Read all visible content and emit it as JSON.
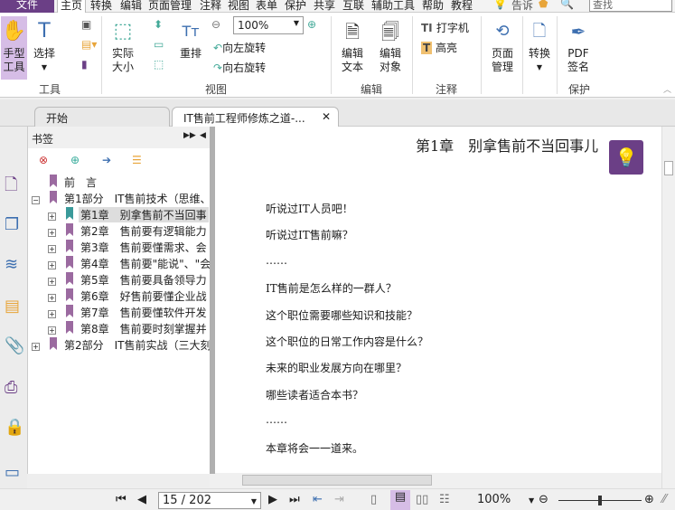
{
  "menu": {
    "file": "文件",
    "items": [
      "主页",
      "转换",
      "编辑",
      "页面管理",
      "注释",
      "视图",
      "表单",
      "保护",
      "共享",
      "互联",
      "辅助工具",
      "帮助",
      "教程"
    ],
    "tell": "告诉",
    "search_placeholder": "查找"
  },
  "ribbon": {
    "hand": "手型\n工具",
    "select": "选择",
    "tools_group": "工具",
    "actual_size": "实际\n大小",
    "reflow": "重排",
    "zoom_value": "100%",
    "rotate_left": "向左旋转",
    "rotate_right": "向右旋转",
    "view_group": "视图",
    "edit_text": "编辑\n文本",
    "edit_object": "编辑\n对象",
    "edit_group": "编辑",
    "typewriter": "打字机",
    "highlight": "高亮",
    "comment_group": "注释",
    "page_manage": "页面\n管理",
    "convert": "转换",
    "pdf_sign": "PDF\n签名",
    "protect_group": "保护"
  },
  "tabs": [
    {
      "label": "开始"
    },
    {
      "label": "IT售前工程师修炼之道-..."
    }
  ],
  "panel": {
    "title": "书签",
    "tree": [
      {
        "label": "前　言",
        "level": 0
      },
      {
        "label": "第1部分　IT售前技术（思维、",
        "level": 0,
        "expander": "−"
      },
      {
        "label": "第1章　别拿售前不当回事",
        "level": 1,
        "expander": "+",
        "selected": true
      },
      {
        "label": "第2章　售前要有逻辑能力",
        "level": 1,
        "expander": "+"
      },
      {
        "label": "第3章　售前要懂需求、会",
        "level": 1,
        "expander": "+"
      },
      {
        "label": "第4章　售前要\"能说\"、\"会",
        "level": 1,
        "expander": "+"
      },
      {
        "label": "第5章　售前要具备领导力",
        "level": 1,
        "expander": "+"
      },
      {
        "label": "第6章　好售前要懂企业战",
        "level": 1,
        "expander": "+"
      },
      {
        "label": "第7章　售前要懂软件开发",
        "level": 1,
        "expander": "+"
      },
      {
        "label": "第8章　售前要时刻掌握并",
        "level": 1,
        "expander": "+"
      },
      {
        "label": "第2部分　IT售前实战（三大刻",
        "level": 0,
        "expander": "+"
      }
    ]
  },
  "document": {
    "heading": "第1章　别拿售前不当回事儿",
    "lines": [
      "听说过IT人员吧！",
      "听说过IT售前嘛？",
      "……",
      "IT售前是怎么样的一群人？",
      "这个职位需要哪些知识和技能？",
      "这个职位的日常工作内容是什么？",
      "未来的职业发展方向在哪里？",
      "哪些读者适合本书？",
      "……",
      "本章将会一一道来。"
    ]
  },
  "status": {
    "page": "15 / 202",
    "zoom": "100%",
    "zoom_slider_percent": 50
  },
  "colors": {
    "accent": "#6b3f86",
    "bookmark": "#9b6aa0",
    "selected_bookmark": "#3a9a9a"
  }
}
